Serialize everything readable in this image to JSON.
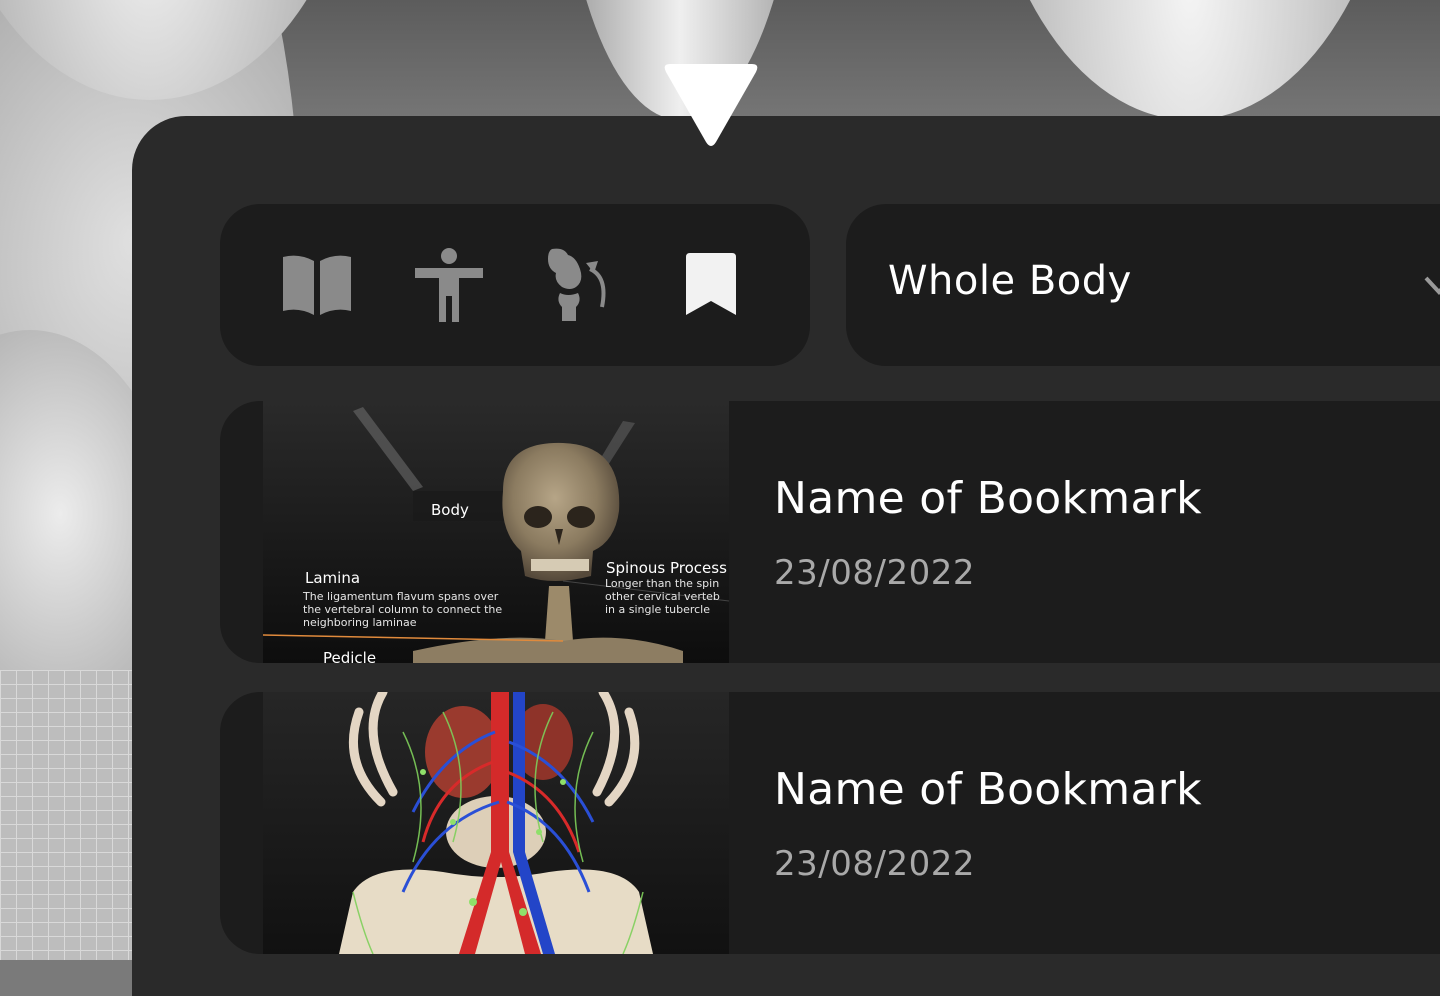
{
  "selector": {
    "label": "Whole Body"
  },
  "toolbar": {
    "tools": [
      {
        "icon": "book-icon"
      },
      {
        "icon": "body-icon"
      },
      {
        "icon": "joint-rotate-icon"
      },
      {
        "icon": "bookmark-icon"
      }
    ]
  },
  "bookmarks": [
    {
      "title": "Name of Bookmark",
      "date": "23/08/2022",
      "thumbnail": {
        "body_label": "Body",
        "lamina_title": "Lamina",
        "lamina_text_1": "The ligamentum flavum spans over",
        "lamina_text_2": "the vertebral column to connect the",
        "lamina_text_3": "neighboring laminae",
        "spinous_title": "Spinous Process",
        "spinous_text_1": "Longer than the spin",
        "spinous_text_2": "other cervical verteb",
        "spinous_text_3": "in a single tubercle",
        "pedicle_label": "Pedicle"
      }
    },
    {
      "title": "Name of Bookmark",
      "date": "23/08/2022"
    }
  ],
  "colors": {
    "panel": "#2a2a2a",
    "card": "#1c1c1c",
    "text_primary": "#ffffff",
    "text_secondary": "#a9a9a9",
    "icon_inactive": "#8a8a8a",
    "icon_active": "#f2f2f2"
  }
}
